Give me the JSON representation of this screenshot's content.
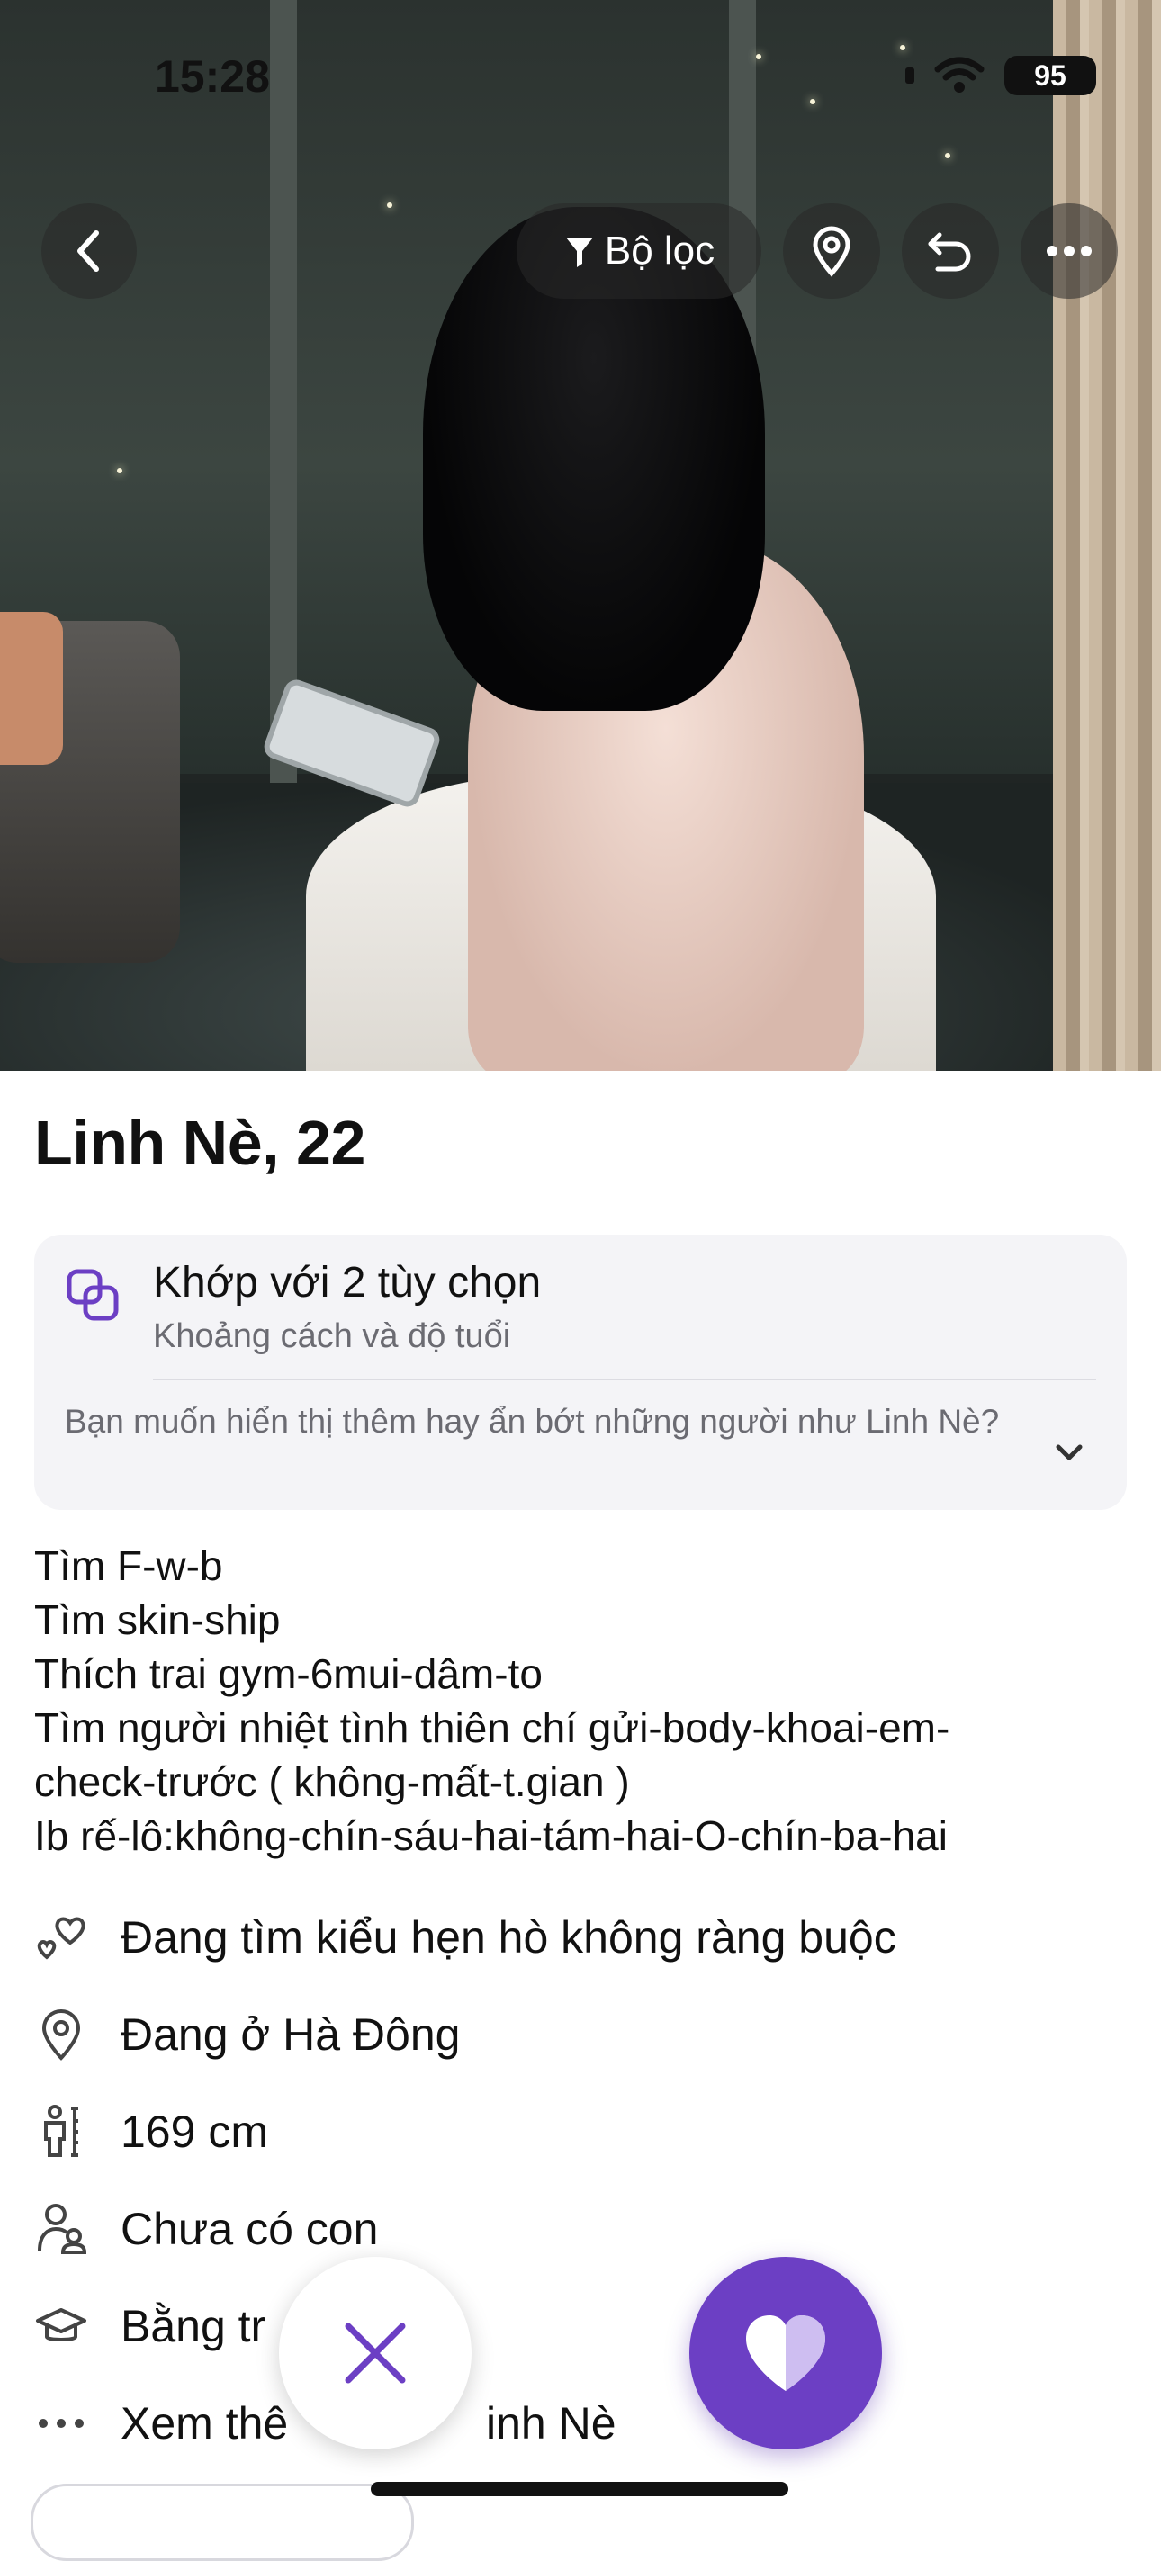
{
  "status_bar": {
    "time": "15:28",
    "battery": "95"
  },
  "nav": {
    "filter_label": "Bộ lọc"
  },
  "profile": {
    "name_age": "Linh Nè, 22",
    "match": {
      "title": "Khớp với 2 tùy chọn",
      "subtitle": "Khoảng cách và độ tuổi",
      "question": "Bạn muốn hiển thị thêm hay ẩn bớt những người như Linh Nè?"
    },
    "bio_lines": [
      "Tìm F-w-b",
      "Tìm skin-ship",
      "Thích trai gym-6mui-dâm-to",
      "Tìm người nhiệt tình thiên chí gửi-body-khoai-em-",
      "check-trước ( không-mất-t.gian )",
      "Ib rế-lô:không-chín-sáu-hai-tám-hai-O-chín-ba-hai"
    ],
    "details": [
      {
        "icon": "hearts-icon",
        "text": "Đang tìm kiểu hẹn hò không ràng buộc"
      },
      {
        "icon": "location-pin-icon",
        "text": "Đang ở Hà Đông"
      },
      {
        "icon": "height-icon",
        "text": "169 cm"
      },
      {
        "icon": "family-icon",
        "text": "Chưa có con"
      },
      {
        "icon": "graduation-cap-icon",
        "text": "Bằng tr"
      },
      {
        "icon": "more-dots-icon",
        "text": "Xem thê"
      }
    ],
    "see_more_tail": "inh Nè"
  },
  "colors": {
    "accent": "#6c3fc4",
    "card_bg": "#f4f4f7",
    "muted_text": "#6b6b72"
  }
}
